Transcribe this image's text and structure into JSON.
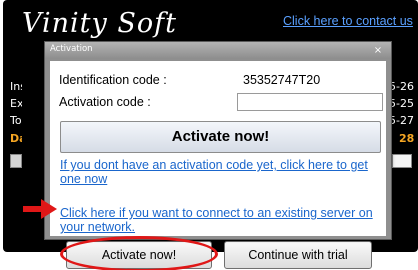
{
  "app": {
    "logo_text": "Vinity Soft",
    "contact_link": "Click here to contact us",
    "left_labels": [
      "Insta",
      "Expi",
      "Toda",
      "Day"
    ],
    "right_values": [
      "5-26",
      "5-25",
      "5-27",
      "28"
    ],
    "buttons": {
      "activate": "Activate now!",
      "trial": "Continue with trial"
    }
  },
  "dialog": {
    "title": "Activation",
    "close_glyph": "×",
    "identification_label": "Identification code :",
    "identification_value": "35352747T20",
    "activation_label": "Activation code :",
    "activation_value": "",
    "activate_button": "Activate now!",
    "link_no_code": "If you dont have an activation code yet, click here to get one now",
    "link_server": "Click here if you want to connect to an existing server on your network."
  },
  "annotations": {
    "arrow_color": "#e01717",
    "ellipse_color": "#e01717"
  }
}
